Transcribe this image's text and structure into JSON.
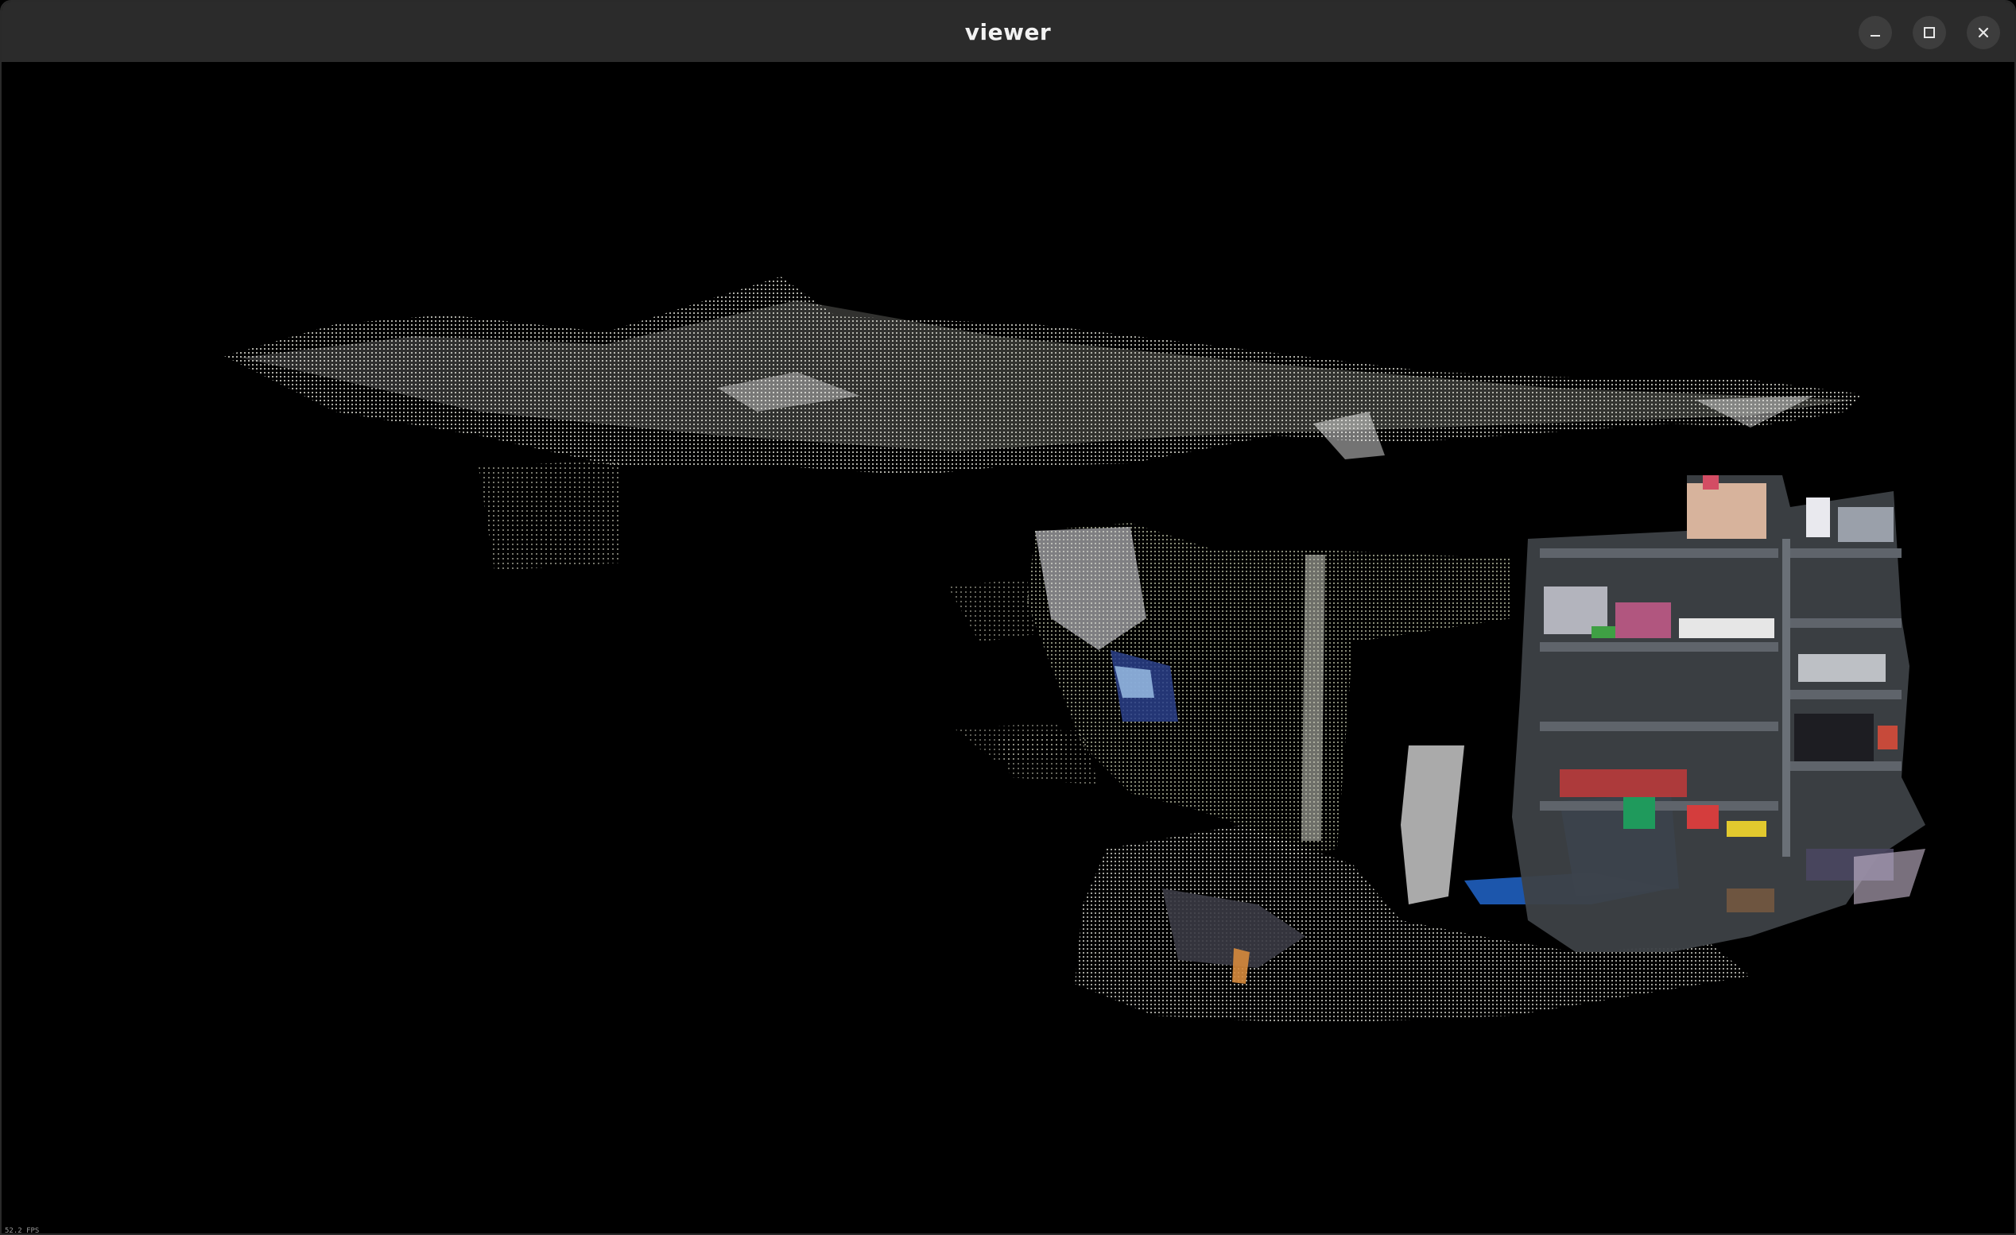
{
  "window": {
    "title": "viewer"
  },
  "controls": {
    "minimize_icon": "minimize-icon",
    "maximize_icon": "maximize-icon",
    "close_icon": "close-icon"
  },
  "viewport": {
    "background": "#000000",
    "fps_label": "52.2 FPS"
  }
}
